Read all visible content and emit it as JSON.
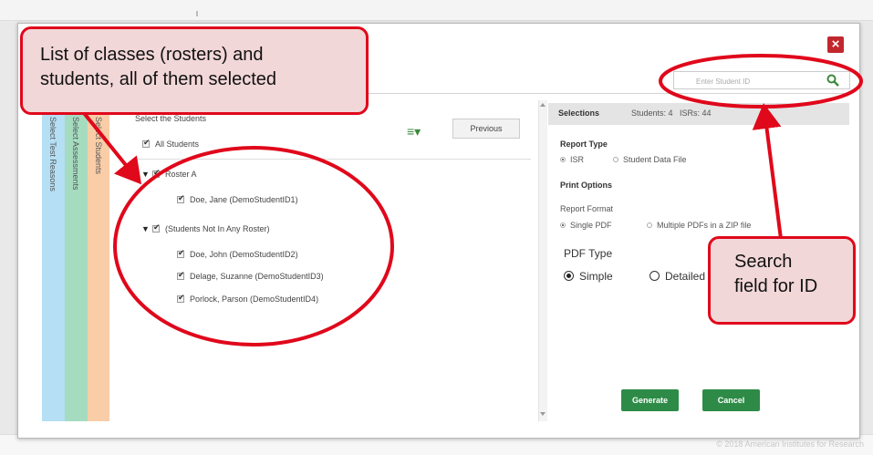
{
  "background": {
    "footer_text": "© 2018 American Institutes for Research"
  },
  "modal": {
    "close_label": "×",
    "search": {
      "placeholder": "Enter Student ID"
    },
    "tabs": [
      {
        "label": "1. Select Test Reasons",
        "color": "#b5dff4"
      },
      {
        "label": "2. Select Assessments",
        "color": "#a5dcc0"
      },
      {
        "label": "3. Select Students",
        "color": "#f8cda7"
      }
    ],
    "list": {
      "header": "Select the Students",
      "menu_icon": "≡▾",
      "previous_label": "Previous",
      "all_students": "All Students",
      "rosters": [
        {
          "name": "Roster A",
          "students": [
            "Doe, Jane (DemoStudentID1)"
          ]
        },
        {
          "name": "(Students Not In Any Roster)",
          "students": [
            "Doe, John (DemoStudentID2)",
            "Delage, Suzanne (DemoStudentID3)",
            "Porlock, Parson (DemoStudentID4)"
          ]
        }
      ]
    },
    "selections": {
      "title": "Selections",
      "students": "Students: 4",
      "isrs": "ISRs: 44",
      "report_type_label": "Report Type",
      "report_type_options": [
        "ISR",
        "Student Data File"
      ],
      "print_options_label": "Print Options",
      "report_format_label": "Report Format",
      "report_format_options": [
        "Single PDF",
        "Multiple PDFs in a ZIP file"
      ],
      "pdf_type_label": "PDF Type",
      "pdf_type_options": [
        "Simple",
        "Detailed"
      ],
      "generate_label": "Generate",
      "cancel_label": "Cancel"
    }
  },
  "annotations": {
    "callout_list_lines": [
      "List of classes (rosters) and",
      "students, all of them selected"
    ],
    "callout_search_lines": [
      "Search",
      "field for ID"
    ],
    "accent_color": "#e0081b"
  }
}
